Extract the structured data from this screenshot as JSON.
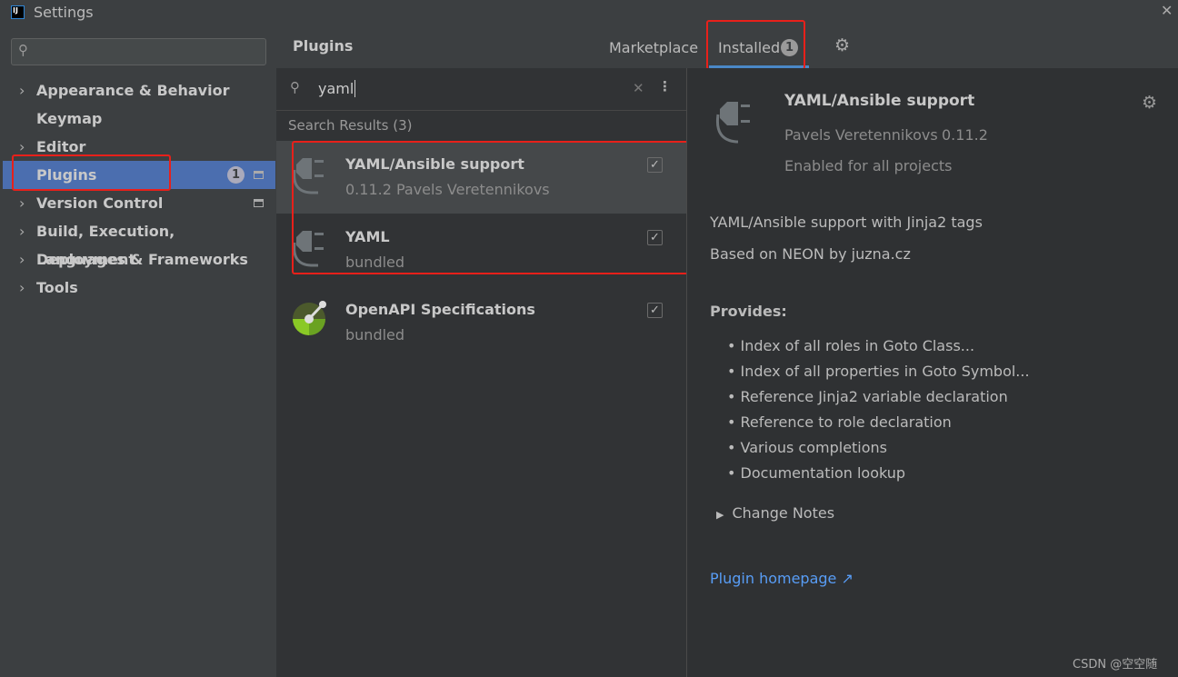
{
  "window": {
    "title": "Settings",
    "logo": "IJ"
  },
  "sidebar": {
    "search_placeholder": "",
    "items": [
      {
        "label": "Appearance & Behavior",
        "expandable": true
      },
      {
        "label": "Keymap",
        "expandable": false
      },
      {
        "label": "Editor",
        "expandable": true
      },
      {
        "label": "Plugins",
        "expandable": false,
        "selected": true,
        "badge": "1"
      },
      {
        "label": "Version Control",
        "expandable": true
      },
      {
        "label": "Build, Execution, Deployment",
        "expandable": true
      },
      {
        "label": "Languages & Frameworks",
        "expandable": true
      },
      {
        "label": "Tools",
        "expandable": true
      }
    ]
  },
  "header": {
    "title": "Plugins",
    "tabs": [
      {
        "label": "Marketplace"
      },
      {
        "label": "Installed",
        "badge": "1",
        "active": true
      }
    ]
  },
  "search": {
    "value": "yaml"
  },
  "results": {
    "label": "Search Results (3)",
    "items": [
      {
        "name": "YAML/Ansible support",
        "sub": "0.11.2  Pavels Veretennikovs",
        "checked": true
      },
      {
        "name": "YAML",
        "sub": "bundled",
        "checked": true
      },
      {
        "name": "OpenAPI Specifications",
        "sub": "bundled",
        "checked": true
      }
    ]
  },
  "detail": {
    "name": "YAML/Ansible support",
    "vendor": "Pavels Veretennikovs",
    "version": "0.11.2",
    "status": "Enabled for all projects",
    "desc1": "YAML/Ansible support with Jinja2 tags",
    "desc2": "Based on NEON by juzna.cz",
    "provides_label": "Provides:",
    "provides": [
      "Index of all roles in Goto Class...",
      "Index of all properties in Goto Symbol...",
      "Reference Jinja2 variable declaration",
      "Reference to role declaration",
      "Various completions",
      "Documentation lookup"
    ],
    "change_notes": "Change Notes",
    "homepage": "Plugin homepage ↗"
  },
  "watermark": "CSDN @空空随",
  "colors": {
    "selection": "#4b6eaf",
    "link": "#589df6",
    "annotation": "#e8201a"
  }
}
